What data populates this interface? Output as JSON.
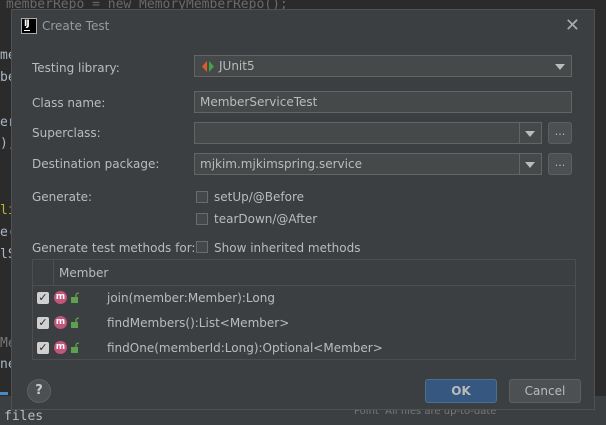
{
  "background_editor": {
    "top_code": "memberRepo = new MemoryMemberRepo();",
    "bottom_left": "files",
    "bottom_right": "Point  All files are up-to-date"
  },
  "dialog": {
    "title": "Create Test",
    "testing_library": {
      "label": "Testing library:",
      "value": "JUnit5"
    },
    "class_name": {
      "label": "Class name:",
      "value": "MemberServiceTest"
    },
    "superclass": {
      "label": "Superclass:",
      "value": "",
      "browse_label": "..."
    },
    "destination_package": {
      "label": "Destination package:",
      "value": "mjkim.mjkimspring.service",
      "browse_label": "..."
    },
    "generate": {
      "label": "Generate:",
      "options": [
        {
          "label": "setUp/@Before",
          "checked": false
        },
        {
          "label": "tearDown/@After",
          "checked": false
        }
      ]
    },
    "generate_methods_for": {
      "label": "Generate test methods for:",
      "show_inherited": {
        "label": "Show inherited methods",
        "checked": false
      }
    },
    "members_table": {
      "header": "Member",
      "rows": [
        {
          "signature": "join(member:Member):Long",
          "checked": true,
          "icon": "m"
        },
        {
          "signature": "findMembers():List<Member>",
          "checked": true,
          "icon": "m"
        },
        {
          "signature": "findOne(memberId:Long):Optional<Member>",
          "checked": true,
          "icon": "m"
        }
      ]
    },
    "buttons": {
      "help": "?",
      "ok": "OK",
      "cancel": "Cancel"
    }
  },
  "colors": {
    "dialog_bg": "#3c3f41",
    "ok_button": "#365880",
    "method_icon": "#c1557a"
  }
}
